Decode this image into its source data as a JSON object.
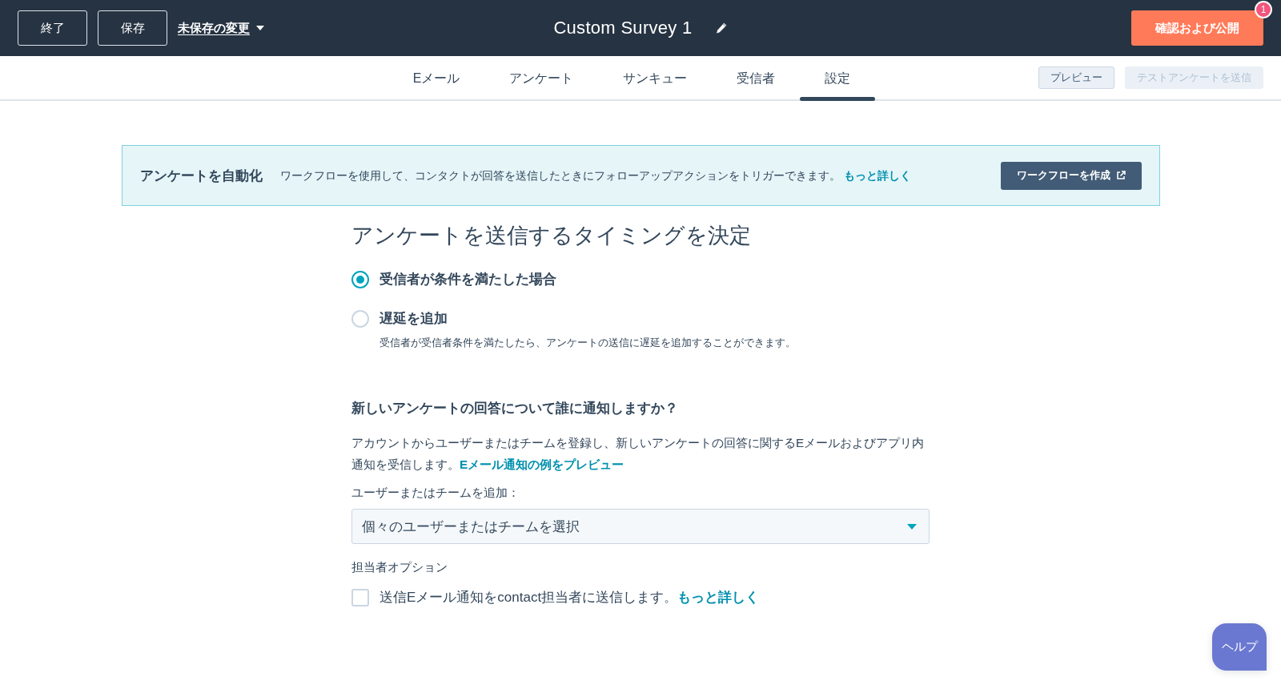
{
  "top_bar": {
    "exit_button": "終了",
    "save_button": "保存",
    "unsaved_changes": "未保存の変更",
    "title": "Custom Survey 1",
    "publish_button": "確認および公開",
    "publish_badge": "1"
  },
  "tabs": [
    {
      "label": "Eメール",
      "selected": false
    },
    {
      "label": "アンケート",
      "selected": false
    },
    {
      "label": "サンキュー",
      "selected": false
    },
    {
      "label": "受信者",
      "selected": false
    },
    {
      "label": "設定",
      "selected": true
    }
  ],
  "tab_actions": [
    {
      "label": "プレビュー",
      "disabled": false
    },
    {
      "label": "テストアンケートを送信",
      "disabled": true
    }
  ],
  "banner": {
    "title": "アンケートを自動化",
    "text": "ワークフローを使用して、コンタクトが回答を送信したときにフォローアップアクションをトリガーできます。",
    "link": "もっと詳しく",
    "button": "ワークフローを作成"
  },
  "timing": {
    "heading": "アンケートを送信するタイミングを決定",
    "options": [
      {
        "label": "受信者が条件を満たした場合",
        "selected": true
      },
      {
        "label": "遅延を追加",
        "selected": false,
        "description": "受信者が受信者条件を満たしたら、アンケートの送信に遅延を追加することができます。"
      }
    ]
  },
  "notify": {
    "heading": "新しいアンケートの回答について誰に通知しますか？",
    "text": "アカウントからユーザーまたはチームを登録し、新しいアンケートの回答に関するEメールおよびアプリ内通知を受信します。",
    "link": "Eメール通知の例をプレビュー",
    "field_label": "ユーザーまたはチームを追加：",
    "select": {
      "value": "個々のユーザーまたはチームを選択"
    },
    "owner_label": "担当者オプション",
    "owner_option": {
      "label": "送信Eメール通知をcontact担当者に送信します。",
      "link": "もっと詳しく",
      "checked": false
    }
  },
  "help_button": "ヘルプ"
}
